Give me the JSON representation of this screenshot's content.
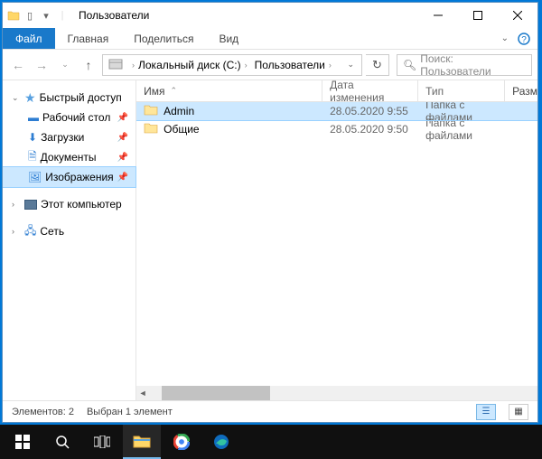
{
  "titlebar": {
    "title": "Пользователи"
  },
  "ribbon": {
    "file": "Файл",
    "tabs": [
      "Главная",
      "Поделиться",
      "Вид"
    ]
  },
  "address": {
    "crumbs": [
      "Локальный диск (C:)",
      "Пользователи"
    ]
  },
  "search": {
    "placeholder": "Поиск: Пользователи"
  },
  "columns": {
    "name": "Имя",
    "date": "Дата изменения",
    "type": "Тип",
    "size": "Размер"
  },
  "sidebar": {
    "quick": "Быстрый доступ",
    "quick_items": [
      {
        "label": "Рабочий стол"
      },
      {
        "label": "Загрузки"
      },
      {
        "label": "Документы"
      },
      {
        "label": "Изображения"
      }
    ],
    "pc": "Этот компьютер",
    "net": "Сеть"
  },
  "rows": [
    {
      "name": "Admin",
      "date": "28.05.2020 9:55",
      "type": "Папка с файлами",
      "selected": true
    },
    {
      "name": "Общие",
      "date": "28.05.2020 9:50",
      "type": "Папка с файлами",
      "selected": false
    }
  ],
  "status": {
    "count": "Элементов: 2",
    "selected": "Выбран 1 элемент"
  }
}
